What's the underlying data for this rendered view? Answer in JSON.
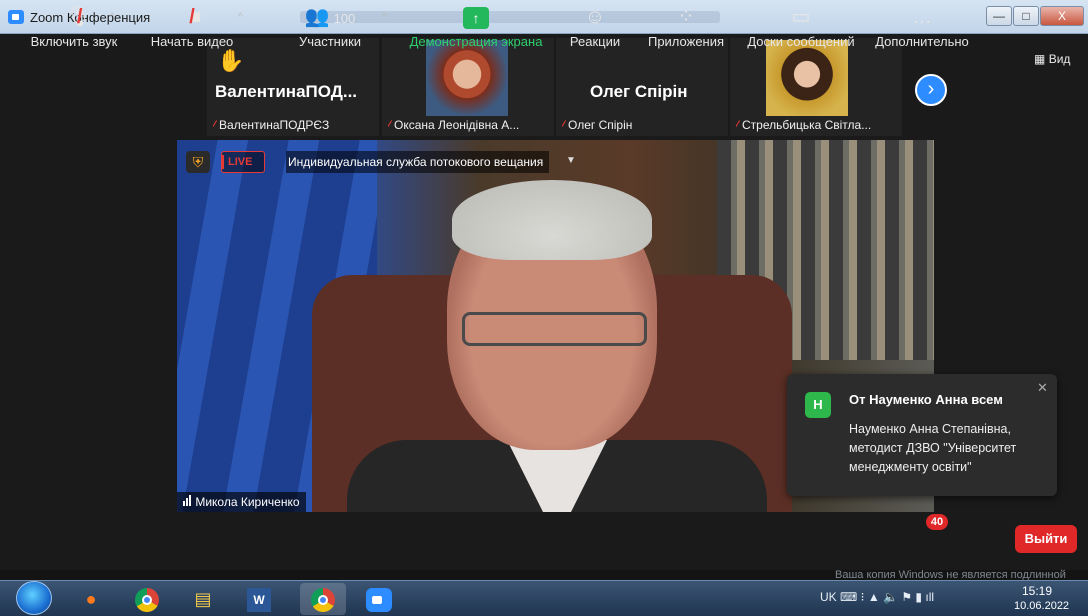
{
  "window": {
    "title": "Zoom Конференция",
    "minimize": "—",
    "maximize": "□",
    "close": "X"
  },
  "view_button": "Вид",
  "thumbnails": [
    {
      "display_name": "ВалентинаПОД...",
      "label": "ВалентинаПОДРЄЗ",
      "hand_raised": true
    },
    {
      "label": "Оксана Леонідівна А..."
    },
    {
      "display_name": "Олег Спірін",
      "label": "Олег Спірін"
    },
    {
      "label": "Стрельбицька Світла..."
    }
  ],
  "next_page_icon": "›",
  "stream": {
    "live": "LIVE",
    "service": "Индивидуальная служба потокового вещания"
  },
  "speaker": {
    "name": "Микола Кириченко"
  },
  "chat": {
    "avatar_letter": "H",
    "header": "От Науменко Анна всем",
    "message": "Науменко Анна Степанівна, методист ДЗВО \"Університет менеджменту освіти\"",
    "close": "✕"
  },
  "toolbar": {
    "audio": "Включить звук",
    "video": "Начать видео",
    "participants": "Участники",
    "participants_count": "100",
    "share": "Демонстрация экрана",
    "reactions": "Реакции",
    "apps": "Приложения",
    "boards": "Доски сообщений",
    "more": "Дополнительно",
    "more_badge": "40",
    "leave": "Выйти"
  },
  "watermark": "Ваша копия Windows не является подлинной",
  "taskbar": {
    "language": "UK",
    "time": "15:19",
    "date": "10.06.2022"
  },
  "colors": {
    "zoom_blue": "#2d8cff",
    "share_green": "#2ed06c",
    "leave_red": "#e02828",
    "live_red": "#e53935"
  }
}
